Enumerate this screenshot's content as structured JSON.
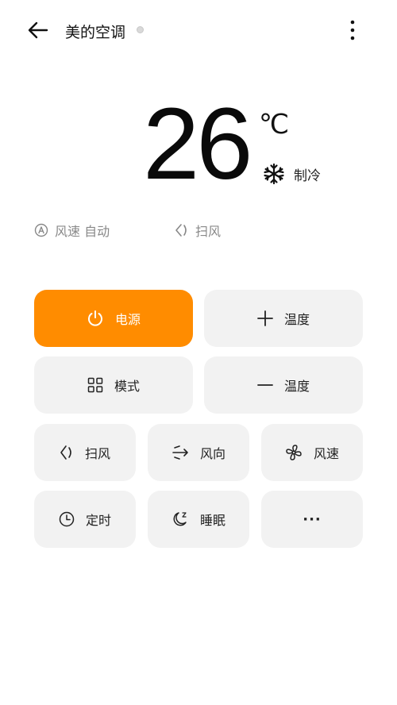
{
  "header": {
    "title": "美的空调"
  },
  "display": {
    "temperature": "26",
    "unit": "℃",
    "mode": "制冷"
  },
  "status": {
    "fan_speed": "风速 自动",
    "swing": "扫风"
  },
  "controls": {
    "power": "电源",
    "temp_up": "温度",
    "mode": "模式",
    "temp_down": "温度",
    "swing": "扫风",
    "direction": "风向",
    "fan_speed": "风速",
    "timer": "定时",
    "sleep": "睡眠",
    "more": "···"
  },
  "colors": {
    "accent": "#ff8c00",
    "button_bg": "#f2f2f2"
  }
}
